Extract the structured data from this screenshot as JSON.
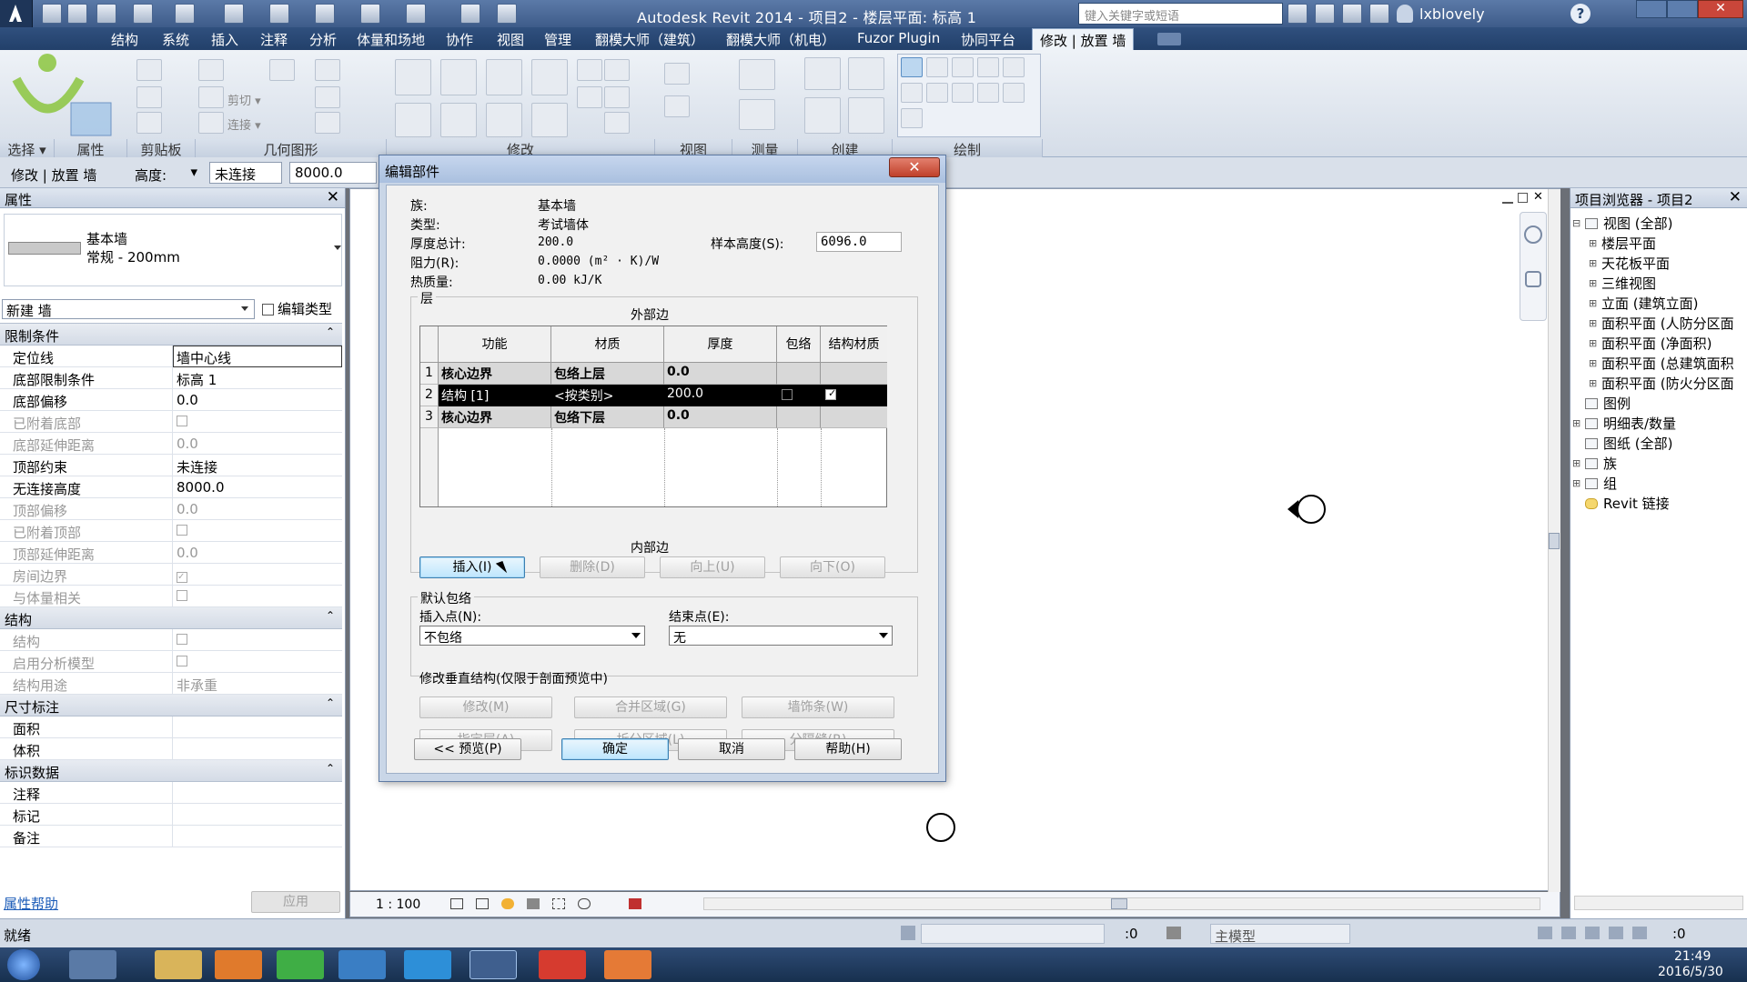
{
  "app": {
    "title": "Autodesk Revit 2014 -    项目2 - 楼层平面: 标高 1",
    "search_placeholder": "键入关键字或短语",
    "user": "lxblovely"
  },
  "menu": [
    "结构",
    "系统",
    "插入",
    "注释",
    "分析",
    "体量和场地",
    "协作",
    "视图",
    "管理",
    "翻模大师（建筑）",
    "翻模大师（机电）",
    "Fuzor Plugin",
    "协同平台",
    "修改 | 放置 墙"
  ],
  "ribbon_panels": [
    "选择 ▾",
    "属性",
    "剪贴板",
    "几何图形",
    "修改",
    "视图",
    "测量",
    "创建",
    "绘制"
  ],
  "ribbon_small": [
    "连接 ▾",
    "剪切 ▾",
    "连接 ▾"
  ],
  "options_bar": {
    "context": "修改 | 放置 墙",
    "height_label": "高度:",
    "height_value": "▾",
    "connect_value": "未连接",
    "height_num": "8000.0"
  },
  "properties": {
    "title": "属性",
    "type_name": "基本墙",
    "type_sub": "常规 - 200mm",
    "instance_filter": "新建 墙",
    "edit_type": "编辑类型",
    "categories": [
      {
        "name": "限制条件",
        "rows": [
          {
            "k": "定位线",
            "v": "墙中心线"
          },
          {
            "k": "底部限制条件",
            "v": "标高 1"
          },
          {
            "k": "底部偏移",
            "v": "0.0"
          },
          {
            "k": "已附着底部",
            "v": ""
          },
          {
            "k": "底部延伸距离",
            "v": "0.0"
          },
          {
            "k": "顶部约束",
            "v": "未连接"
          },
          {
            "k": "无连接高度",
            "v": "8000.0"
          },
          {
            "k": "顶部偏移",
            "v": "0.0"
          },
          {
            "k": "已附着顶部",
            "v": ""
          },
          {
            "k": "顶部延伸距离",
            "v": "0.0"
          },
          {
            "k": "房间边界",
            "v": ""
          },
          {
            "k": "与体量相关",
            "v": ""
          }
        ]
      },
      {
        "name": "结构",
        "rows": [
          {
            "k": "结构",
            "v": ""
          },
          {
            "k": "启用分析模型",
            "v": ""
          },
          {
            "k": "结构用途",
            "v": "非承重"
          }
        ]
      },
      {
        "name": "尺寸标注",
        "rows": [
          {
            "k": "面积",
            "v": ""
          },
          {
            "k": "体积",
            "v": ""
          }
        ]
      },
      {
        "name": "标识数据",
        "rows": [
          {
            "k": "注释",
            "v": ""
          },
          {
            "k": "标记",
            "v": ""
          },
          {
            "k": "备注",
            "v": ""
          }
        ]
      }
    ],
    "help": "属性帮助",
    "apply": "应用"
  },
  "dialog": {
    "title": "编辑部件",
    "family_label": "族:",
    "family": "基本墙",
    "type_label": "类型:",
    "type": "考试墙体",
    "thickness_label": "厚度总计:",
    "thickness": "200.0",
    "resistance_label": "阻力(R):",
    "resistance": "0.0000 (m² · K)/W",
    "thermal_label": "热质量:",
    "thermal": "0.00 kJ/K",
    "sample_label": "样本高度(S):",
    "sample": "6096.0",
    "layers_label": "层",
    "exterior": "外部边",
    "interior": "内部边",
    "columns": [
      "功能",
      "材质",
      "厚度",
      "包络",
      "结构材质"
    ],
    "rows": [
      {
        "n": "1",
        "func": "核心边界",
        "mat": "包络上层",
        "thk": "0.0"
      },
      {
        "n": "2",
        "func": "结构 [1]",
        "mat": "<按类别>",
        "thk": "200.0"
      },
      {
        "n": "3",
        "func": "核心边界",
        "mat": "包络下层",
        "thk": "0.0"
      }
    ],
    "btn_insert": "插入(I)",
    "btn_delete": "删除(D)",
    "btn_up": "向上(U)",
    "btn_down": "向下(O)",
    "wrap_group": "默认包络",
    "insert_point_label": "插入点(N):",
    "insert_point": "不包络",
    "end_point_label": "结束点(E):",
    "end_point": "无",
    "vert_group": "修改垂直结构(仅限于剖面预览中)",
    "btn_modify": "修改(M)",
    "btn_merge": "合并区域(G)",
    "btn_sweep": "墙饰条(W)",
    "btn_assign": "指定层(A)",
    "btn_split": "拆分区域(L)",
    "btn_reveal": "分隔缝(R)",
    "btn_preview": "<< 预览(P)",
    "btn_ok": "确定",
    "btn_cancel": "取消",
    "btn_help": "帮助(H)"
  },
  "browser": {
    "title": "项目浏览器 - 项目2",
    "items": [
      "视图 (全部)",
      "楼层平面",
      "天花板平面",
      "三维视图",
      "立面 (建筑立面)",
      "面积平面 (人防分区面",
      "面积平面 (净面积)",
      "面积平面 (总建筑面积",
      "面积平面 (防火分区面",
      "图例",
      "明细表/数量",
      "图纸 (全部)",
      "族",
      "组",
      "Revit 链接"
    ]
  },
  "canvas": {
    "scale": "1 : 100"
  },
  "status": {
    "ready": "就绪",
    "count": ":0",
    "model": "主模型",
    "filter": ":0"
  },
  "taskbar": {
    "time": "21:49",
    "date": "2016/5/30"
  },
  "colors": {
    "ribbon_bg": "#e3e9f1",
    "title_bg": "#4a6a98",
    "selected_row": "#000000"
  }
}
